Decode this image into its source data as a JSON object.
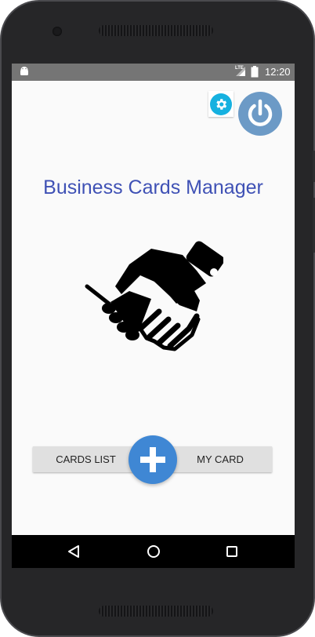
{
  "status_bar": {
    "time": "12:20",
    "network_label": "LTE",
    "icons": [
      "android-icon",
      "signal-icon",
      "battery-icon"
    ]
  },
  "app": {
    "title": "Business Cards Manager",
    "title_color": "#3f51b5",
    "accent_color": "#3f87d4",
    "settings_color": "#16b1e0",
    "power_color": "#6c9ac6"
  },
  "buttons": {
    "cards_list_label": "CARDS LIST",
    "my_card_label": "MY CARD"
  },
  "icons": {
    "settings": "gear-icon",
    "power": "power-icon",
    "hero": "handshake-icon",
    "add": "plus-icon"
  },
  "nav_bar": {
    "buttons": [
      "back-icon",
      "home-icon",
      "recents-icon"
    ]
  }
}
